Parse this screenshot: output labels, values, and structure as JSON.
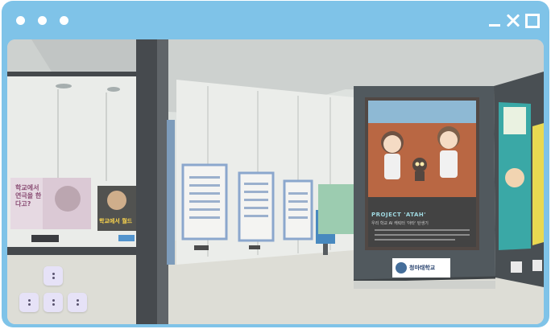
{
  "window": {
    "controls": [
      "minimize-icon",
      "close-icon",
      "maximize-icon"
    ],
    "accent": "#7fc3e8"
  },
  "scene": {
    "left_posters": [
      {
        "text": "학교에서 연극을 한다고?"
      },
      {
        "text": "학교에서 월드"
      }
    ],
    "main_poster": {
      "heading": "PROJECT 'ATAH'",
      "subheading": "우리 학교 AI 캐릭터 '아타' 탄생기",
      "org_label": "청마태학교"
    }
  },
  "controls": {
    "dpad_keys": [
      "up",
      "left",
      "down",
      "right"
    ]
  }
}
